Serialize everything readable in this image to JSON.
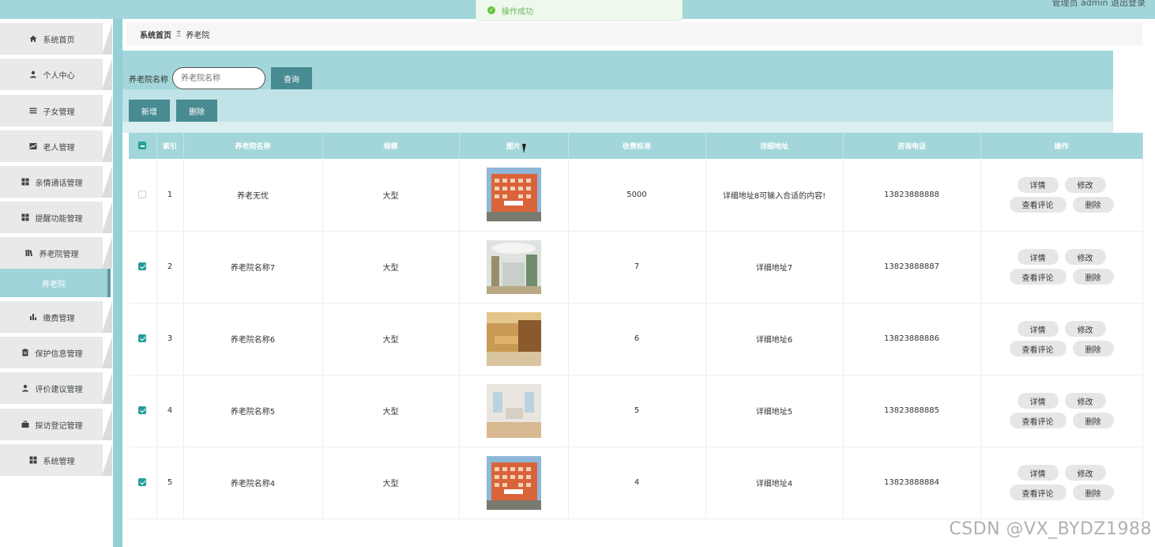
{
  "header": {
    "user_text": "管理员 admin  退出登录"
  },
  "toast": {
    "message": "操作成功"
  },
  "sidebar": {
    "items": [
      {
        "label": "系统首页",
        "icon": "home-icon"
      },
      {
        "label": "个人中心",
        "icon": "user-icon"
      },
      {
        "label": "子女管理",
        "icon": "list-icon"
      },
      {
        "label": "老人管理",
        "icon": "chart-icon"
      },
      {
        "label": "亲情通话管理",
        "icon": "grid-icon"
      },
      {
        "label": "提醒功能管理",
        "icon": "grid-icon"
      },
      {
        "label": "养老院管理",
        "icon": "book-icon"
      },
      {
        "label": "缴费管理",
        "icon": "bar-chart-icon"
      },
      {
        "label": "保护信息管理",
        "icon": "clipboard-icon"
      },
      {
        "label": "评价建议管理",
        "icon": "user-icon"
      },
      {
        "label": "探访登记管理",
        "icon": "briefcase-icon"
      },
      {
        "label": "系统管理",
        "icon": "grid-icon"
      }
    ],
    "active_sub": "养老院"
  },
  "breadcrumb": {
    "home": "系统首页",
    "separator": "Ξ",
    "current": "养老院"
  },
  "search": {
    "label": "养老院名称",
    "placeholder": "养老院名称",
    "query_label": "查询",
    "add_label": "新增",
    "delete_label": "删除"
  },
  "table": {
    "headers": [
      "索引",
      "养老院名称",
      "规模",
      "图片",
      "收费标准",
      "详细地址",
      "咨询电话",
      "操作"
    ],
    "actions": {
      "detail": "详情",
      "edit": "修改",
      "comments": "查看评论",
      "delete": "删除"
    },
    "rows": [
      {
        "checked": false,
        "index": "1",
        "name": "养老无忧",
        "scale": "大型",
        "fee": "5000",
        "address": "详细地址8可输入合适的内容!",
        "phone": "13823888888"
      },
      {
        "checked": true,
        "index": "2",
        "name": "养老院名称7",
        "scale": "大型",
        "fee": "7",
        "address": "详细地址7",
        "phone": "13823888887"
      },
      {
        "checked": true,
        "index": "3",
        "name": "养老院名称6",
        "scale": "大型",
        "fee": "6",
        "address": "详细地址6",
        "phone": "13823888886"
      },
      {
        "checked": true,
        "index": "4",
        "name": "养老院名称5",
        "scale": "大型",
        "fee": "5",
        "address": "详细地址5",
        "phone": "13823888885"
      },
      {
        "checked": true,
        "index": "5",
        "name": "养老院名称4",
        "scale": "大型",
        "fee": "4",
        "address": "详细地址4",
        "phone": "13823888884"
      }
    ]
  },
  "watermark": "CSDN @VX_BYDZ1988",
  "colors": {
    "accent": "#a2d6da",
    "button": "#488b92",
    "check": "#27a096"
  }
}
